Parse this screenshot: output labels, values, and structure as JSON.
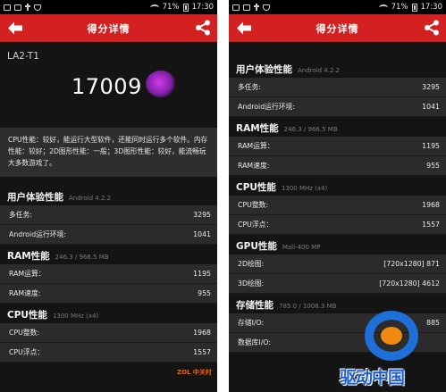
{
  "statusbar": {
    "battery": "71%",
    "time": "17:30"
  },
  "appbar": {
    "title": "得分详情"
  },
  "left": {
    "device": "LA2-T1",
    "score": "17009",
    "summary": "CPU性能：较好，能运行大型软件，还能同时运行多个软件。内存性能：较好；2D图形性能：一般；3D图形性能：较好，能流畅玩大多数游戏了。",
    "sections": [
      {
        "title": "用户体验性能",
        "sub": "Android 4.2.2",
        "rows": [
          {
            "label": "多任务:",
            "value": "3295"
          },
          {
            "label": "Android运行环境:",
            "value": "1041"
          }
        ]
      },
      {
        "title": "RAM性能",
        "sub": "246.3 / 966.5 MB",
        "rows": [
          {
            "label": "RAM运算：",
            "value": "1195"
          },
          {
            "label": "RAM速度:",
            "value": "955"
          }
        ]
      },
      {
        "title": "CPU性能",
        "sub": "1300 MHz (x4)",
        "rows": [
          {
            "label": "CPU整数:",
            "value": "1968"
          },
          {
            "label": "CPU浮点：",
            "value": "1557"
          }
        ]
      }
    ],
    "watermark": "ZOL 中关村"
  },
  "right": {
    "sections": [
      {
        "title": "用户体验性能",
        "sub": "Android 4.2.2",
        "rows": [
          {
            "label": "多任务:",
            "value": "3295"
          },
          {
            "label": "Android运行环境:",
            "value": "1041"
          }
        ]
      },
      {
        "title": "RAM性能",
        "sub": "246.3 / 966.5 MB",
        "rows": [
          {
            "label": "RAM运算：",
            "value": "1195"
          },
          {
            "label": "RAM速度:",
            "value": "955"
          }
        ]
      },
      {
        "title": "CPU性能",
        "sub": "1300 MHz (x4)",
        "rows": [
          {
            "label": "CPU整数:",
            "value": "1968"
          },
          {
            "label": "CPU浮点：",
            "value": "1557"
          }
        ]
      },
      {
        "title": "GPU性能",
        "sub": "Mali-400 MP",
        "rows": [
          {
            "label": "2D绘图:",
            "value": "[720x1280] 871"
          },
          {
            "label": "3D绘图:",
            "value": "[720x1280] 4612"
          }
        ]
      },
      {
        "title": "存储性能",
        "sub": "785.0 / 1008.3 MB",
        "rows": [
          {
            "label": "存储I/O:",
            "value": "885"
          },
          {
            "label": "数据库I/O:",
            "value": ""
          }
        ]
      }
    ]
  },
  "watermark": "驱动中国",
  "colors": {
    "accent": "#d32020",
    "background": "#141414",
    "row": "#2b2b2b"
  }
}
